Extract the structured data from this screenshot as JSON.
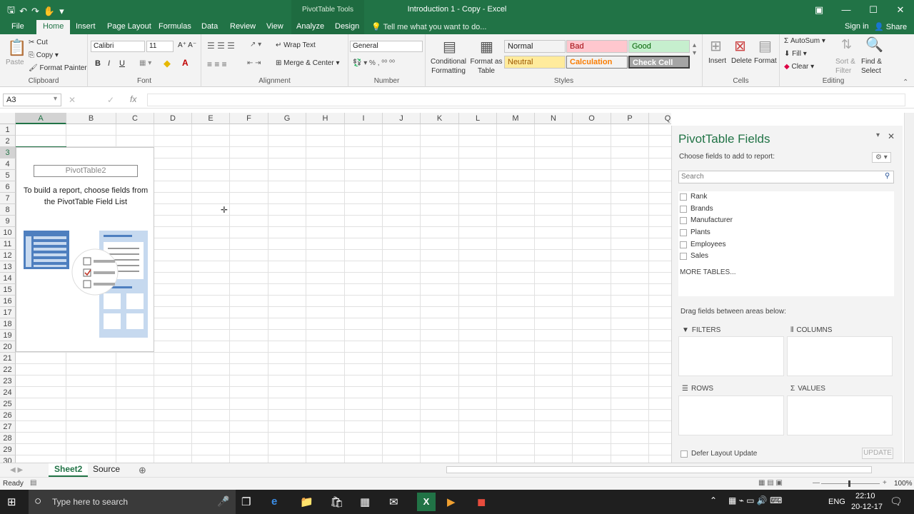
{
  "window": {
    "title": "Introduction 1 - Copy - Excel",
    "contextual_label": "PivotTable Tools",
    "controls": [
      "ribbon-options",
      "minimize",
      "maximize",
      "close"
    ]
  },
  "tabs": [
    "File",
    "Home",
    "Insert",
    "Page Layout",
    "Formulas",
    "Data",
    "Review",
    "View",
    "Analyze",
    "Design"
  ],
  "active_tab": "Home",
  "tell_me": "Tell me what you want to do...",
  "account": {
    "signin": "Sign in",
    "share": "Share"
  },
  "ribbon": {
    "clipboard": {
      "label": "Clipboard",
      "paste": "Paste",
      "cut": "Cut",
      "copy": "Copy",
      "format_painter": "Format Painter"
    },
    "font": {
      "label": "Font",
      "name": "Calibri",
      "size": "11",
      "bold": "B",
      "italic": "I",
      "underline": "U"
    },
    "alignment": {
      "label": "Alignment",
      "wrap": "Wrap Text",
      "merge": "Merge & Center"
    },
    "number": {
      "label": "Number",
      "format": "General"
    },
    "styles": {
      "label": "Styles",
      "conditional": "Conditional Formatting",
      "format_table": "Format as Table",
      "cells": [
        {
          "name": "Normal",
          "bg": "#ffffff",
          "fg": "#000000"
        },
        {
          "name": "Bad",
          "bg": "#ffc7ce",
          "fg": "#9c0006"
        },
        {
          "name": "Good",
          "bg": "#c6efce",
          "fg": "#006100"
        },
        {
          "name": "Neutral",
          "bg": "#ffeb9c",
          "fg": "#9c5700"
        },
        {
          "name": "Calculation",
          "bg": "#f2f2f2",
          "fg": "#fa7d00"
        },
        {
          "name": "Check Cell",
          "bg": "#a5a5a5",
          "fg": "#ffffff"
        }
      ]
    },
    "cells": {
      "label": "Cells",
      "insert": "Insert",
      "delete": "Delete",
      "format": "Format"
    },
    "editing": {
      "label": "Editing",
      "autosum": "AutoSum",
      "fill": "Fill",
      "clear": "Clear",
      "sort": "Sort & Filter",
      "find": "Find & Select"
    }
  },
  "formula_bar": {
    "name_box": "A3",
    "fx": "fx",
    "formula": ""
  },
  "grid": {
    "columns": [
      "A",
      "B",
      "C",
      "D",
      "E",
      "F",
      "G",
      "H",
      "I",
      "J",
      "K",
      "L",
      "M",
      "N",
      "O",
      "P",
      "Q"
    ],
    "rows": [
      1,
      2,
      3,
      4,
      5,
      6,
      7,
      8,
      9,
      10,
      11,
      12,
      13,
      14,
      15,
      16,
      17,
      18,
      19,
      20,
      21,
      22,
      23,
      24,
      25,
      26,
      27,
      28,
      29,
      30
    ],
    "selected_cell": "A3"
  },
  "pivot_placeholder": {
    "name": "PivotTable2",
    "message": "To build a report, choose fields from the PivotTable Field List"
  },
  "pivot_pane": {
    "title": "PivotTable Fields",
    "subtitle": "Choose fields to add to report:",
    "search_placeholder": "Search",
    "fields": [
      "Rank",
      "Brands",
      "Manufacturer",
      "Plants",
      "Employees",
      "Sales"
    ],
    "more_tables": "MORE TABLES...",
    "drag_label": "Drag fields between areas below:",
    "areas": {
      "filters": "FILTERS",
      "columns": "COLUMNS",
      "rows": "ROWS",
      "values": "VALUES"
    },
    "defer": "Defer Layout Update",
    "update": "UPDATE"
  },
  "sheets": [
    "Sheet2",
    "Source"
  ],
  "active_sheet": "Sheet2",
  "status": {
    "ready": "Ready",
    "zoom": "100%"
  },
  "taskbar": {
    "search_placeholder": "Type here to search",
    "lang": "ENG",
    "time": "22:10",
    "date": "20-12-17"
  },
  "accent": "#217346"
}
